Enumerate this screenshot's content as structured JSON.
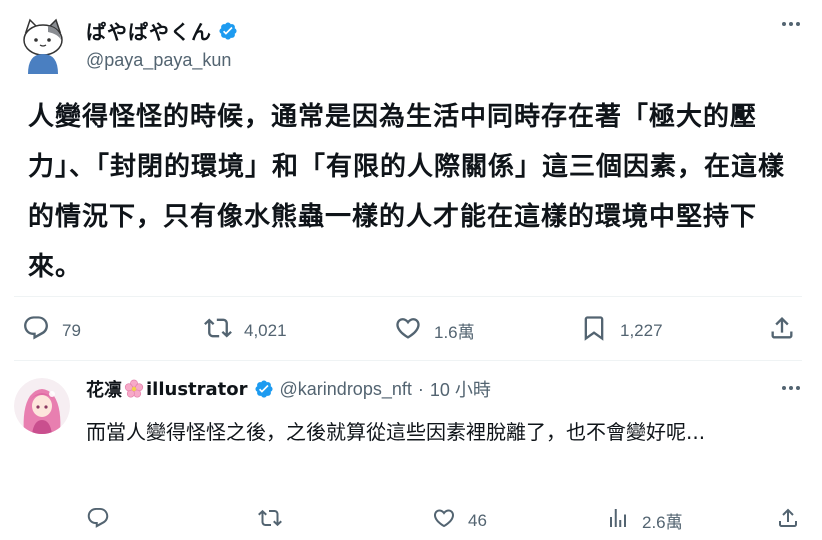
{
  "main_tweet": {
    "display_name": "ぱやぱやくん",
    "handle": "@paya_paya_kun",
    "text": "人變得怪怪的時候，通常是因為生活中同時存在著「極大的壓力」、「封閉的環境」和「有限的人際關係」這三個因素，在這樣的情況下，只有像水熊蟲一樣的人才能在這樣的環境中堅持下來。",
    "replies": "79",
    "reposts": "4,021",
    "likes": "1.6萬",
    "bookmarks": "1,227"
  },
  "reply": {
    "display_name_part1": "花凛",
    "display_name_part2": "illustrator",
    "handle": "@karindrops_nft",
    "separator": "·",
    "time": "10 小時",
    "text": "而當人變得怪怪之後，之後就算從這些因素裡脫離了，也不會變好呢...",
    "replies": "",
    "reposts": "",
    "likes": "46",
    "views": "2.6萬"
  },
  "colors": {
    "verified": "#1d9bf0",
    "muted": "#536471",
    "text": "#0f1419",
    "divider": "#eff3f4"
  }
}
